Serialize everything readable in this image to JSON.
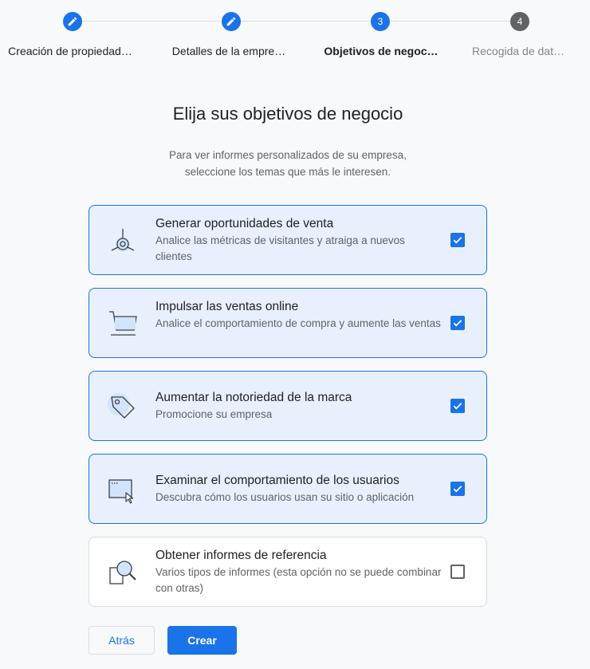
{
  "stepper": {
    "steps": [
      {
        "number": "",
        "label": "Creación de propiedad…",
        "state": "done"
      },
      {
        "number": "",
        "label": "Detalles de la empre…",
        "state": "done"
      },
      {
        "number": "3",
        "label": "Objetivos de negoc…",
        "state": "current"
      },
      {
        "number": "4",
        "label": "Recogida de dat…",
        "state": "upcoming"
      }
    ]
  },
  "main": {
    "title": "Elija sus objetivos de negocio",
    "subtitle_line1": "Para ver informes personalizados de su empresa,",
    "subtitle_line2": "seleccione los temas que más le interesen."
  },
  "objectives": [
    {
      "title": "Generar oportunidades de venta",
      "description": "Analice las métricas de visitantes y atraiga a nuevos clientes",
      "checked": true,
      "icon": "lead-target-icon"
    },
    {
      "title": "Impulsar las ventas online",
      "description": "Analice el comportamiento de compra y aumente las ventas",
      "checked": true,
      "icon": "shopping-cart-icon"
    },
    {
      "title": "Aumentar la notoriedad de la marca",
      "description": "Promocione su empresa",
      "checked": true,
      "icon": "tag-icon"
    },
    {
      "title": "Examinar el comportamiento de los usuarios",
      "description": "Descubra cómo los usuarios usan su sitio o aplicación",
      "checked": true,
      "icon": "browser-cursor-icon"
    },
    {
      "title": "Obtener informes de referencia",
      "description": "Varios tipos de informes (esta opción no se puede combinar con otras)",
      "checked": false,
      "icon": "magnifier-icon"
    }
  ],
  "actions": {
    "back_label": "Atrás",
    "create_label": "Crear"
  },
  "colors": {
    "accent": "#1a73e8",
    "card_selected_bg": "#e8f0fe",
    "upcoming_step": "#5f6368"
  }
}
